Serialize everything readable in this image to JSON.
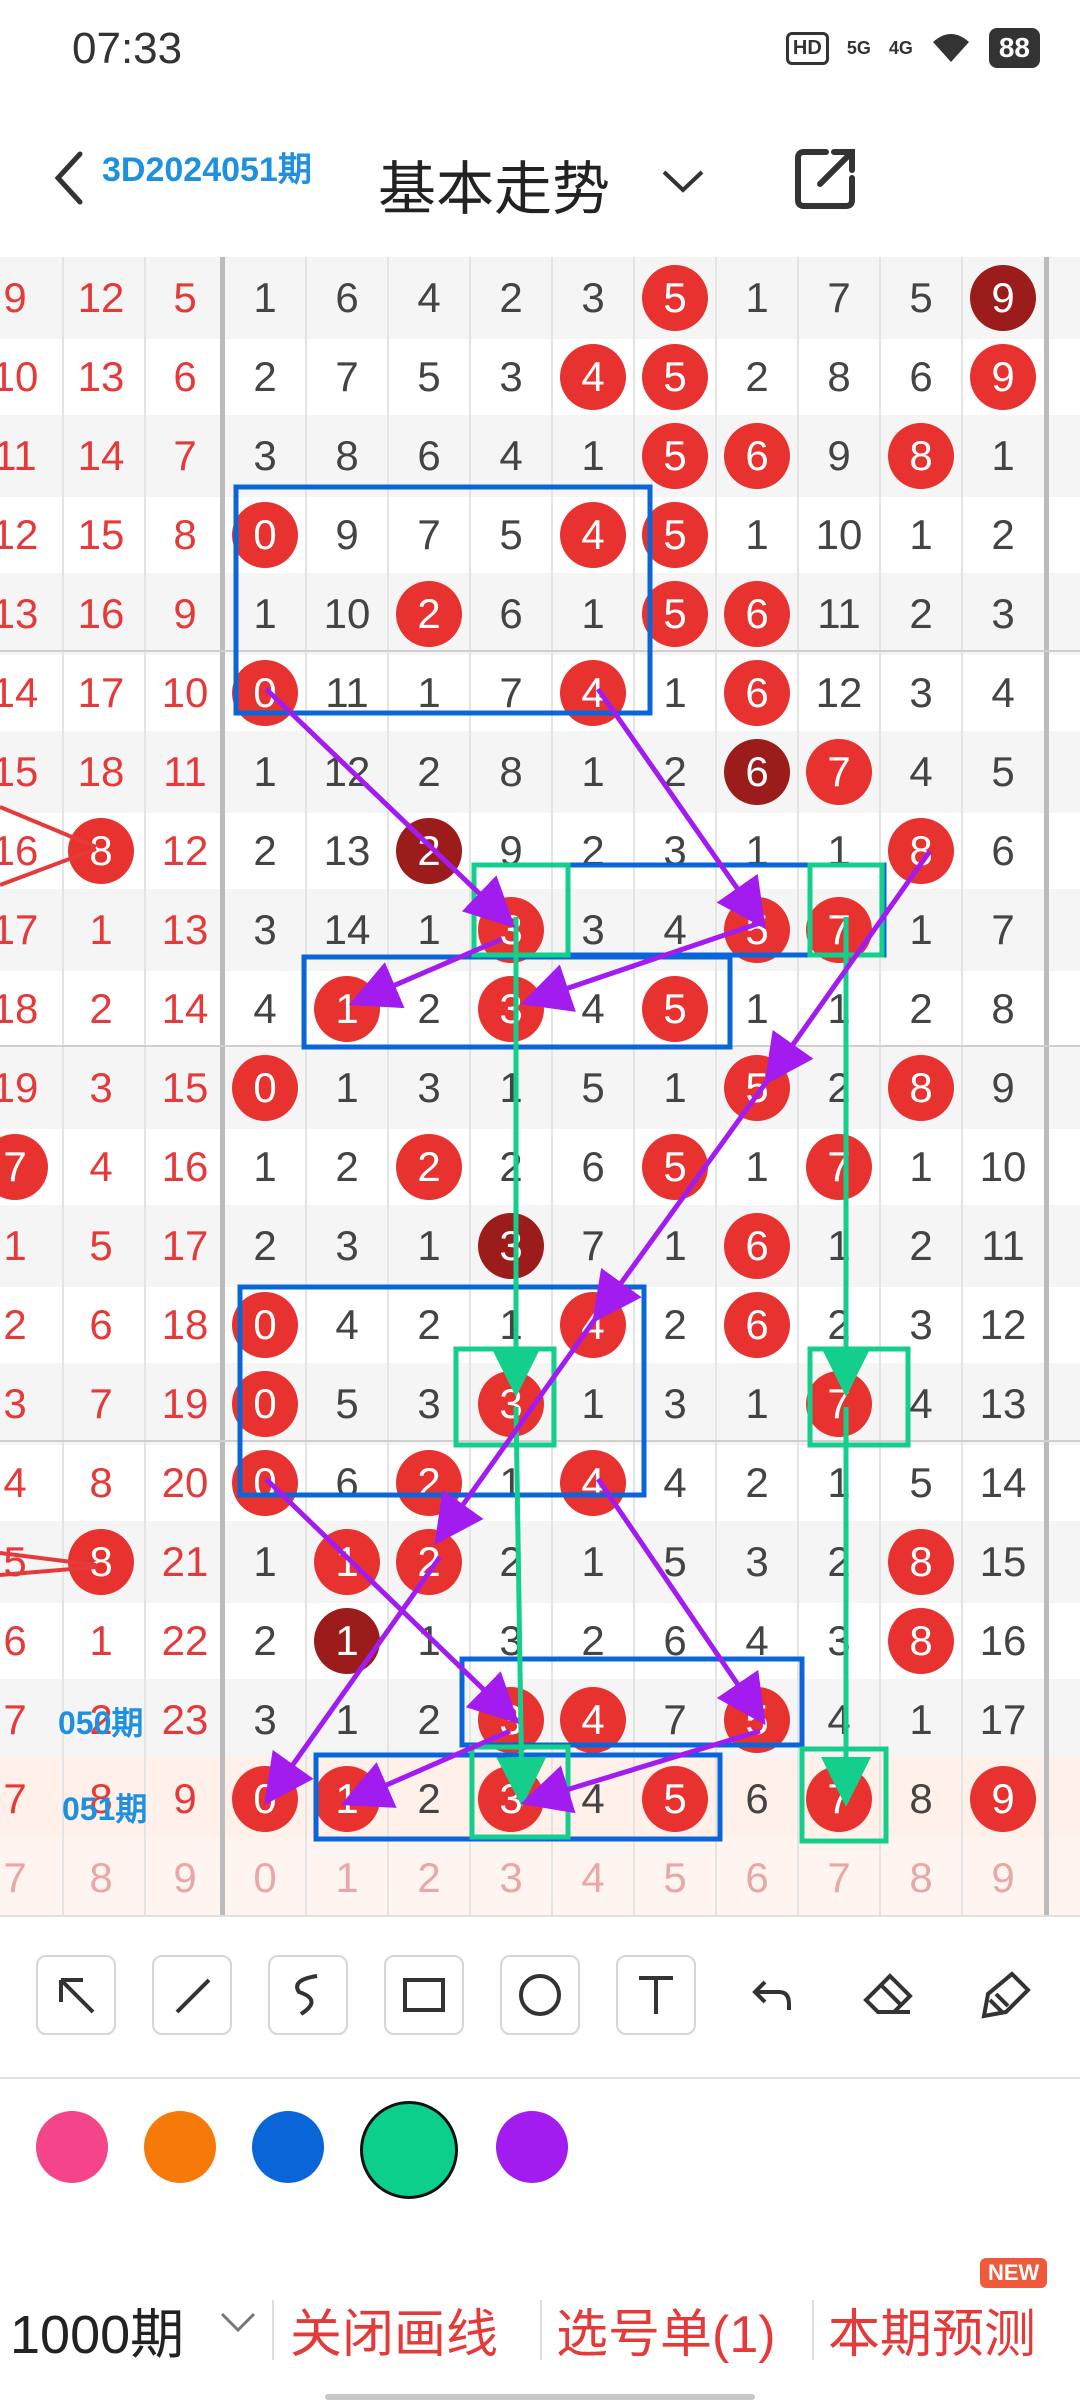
{
  "status": {
    "time": "07:33",
    "hd": "HD",
    "hd_sub": "1 2",
    "sig1": "5G",
    "sig2": "4G",
    "battery": "88"
  },
  "header": {
    "issue": "3D2024051期",
    "title": "基本走势"
  },
  "labels": {
    "row050": "050期",
    "row051": "051期"
  },
  "rows": [
    {
      "l": [
        "9",
        "12",
        "5"
      ],
      "r": [
        "1",
        "6",
        "4",
        "2",
        "3",
        "5",
        "1",
        "7",
        "5",
        "9"
      ],
      "balls": [
        5,
        9
      ],
      "dark": [
        9
      ],
      "bg": "alt"
    },
    {
      "l": [
        "10",
        "13",
        "6"
      ],
      "r": [
        "2",
        "7",
        "5",
        "3",
        "4",
        "5",
        "2",
        "8",
        "6",
        "9"
      ],
      "balls": [
        4,
        5,
        9
      ],
      "dark": [],
      "bg": ""
    },
    {
      "l": [
        "11",
        "14",
        "7"
      ],
      "r": [
        "3",
        "8",
        "6",
        "4",
        "1",
        "5",
        "6",
        "9",
        "8",
        "1"
      ],
      "balls": [
        5,
        6,
        8
      ],
      "dark": [],
      "bg": "alt"
    },
    {
      "l": [
        "12",
        "15",
        "8"
      ],
      "r": [
        "0",
        "9",
        "7",
        "5",
        "4",
        "5",
        "1",
        "10",
        "1",
        "2"
      ],
      "balls": [
        0,
        4,
        5
      ],
      "dark": [],
      "bg": ""
    },
    {
      "l": [
        "13",
        "16",
        "9"
      ],
      "r": [
        "1",
        "10",
        "2",
        "6",
        "1",
        "5",
        "6",
        "11",
        "2",
        "3"
      ],
      "balls": [
        2,
        5,
        6
      ],
      "dark": [],
      "bg": "alt"
    },
    {
      "l": [
        "14",
        "17",
        "10"
      ],
      "r": [
        "0",
        "11",
        "1",
        "7",
        "4",
        "1",
        "6",
        "12",
        "3",
        "4"
      ],
      "balls": [
        0,
        4,
        6
      ],
      "dark": [],
      "bg": ""
    },
    {
      "l": [
        "15",
        "18",
        "11"
      ],
      "r": [
        "1",
        "12",
        "2",
        "8",
        "1",
        "2",
        "6",
        "7",
        "4",
        "5"
      ],
      "balls": [
        6,
        7
      ],
      "dark": [
        6
      ],
      "bg": "alt"
    },
    {
      "l": [
        "16",
        "8",
        "12"
      ],
      "r": [
        "2",
        "13",
        "2",
        "9",
        "2",
        "3",
        "1",
        "1",
        "8",
        "6"
      ],
      "balls": [
        2,
        8
      ],
      "dark": [
        2
      ],
      "lball": [
        1
      ],
      "bg": ""
    },
    {
      "l": [
        "17",
        "1",
        "13"
      ],
      "r": [
        "3",
        "14",
        "1",
        "3",
        "3",
        "4",
        "5",
        "7",
        "1",
        "7"
      ],
      "balls": [
        3,
        6,
        7
      ],
      "dark": [],
      "bg": "alt"
    },
    {
      "l": [
        "18",
        "2",
        "14"
      ],
      "r": [
        "4",
        "1",
        "2",
        "3",
        "4",
        "5",
        "1",
        "1",
        "2",
        "8"
      ],
      "balls": [
        1,
        3,
        5
      ],
      "dark": [],
      "bg": ""
    },
    {
      "l": [
        "19",
        "3",
        "15"
      ],
      "r": [
        "0",
        "1",
        "3",
        "1",
        "5",
        "1",
        "5",
        "2",
        "8",
        "9"
      ],
      "balls": [
        0,
        6,
        8
      ],
      "dark": [],
      "bg": "alt"
    },
    {
      "l": [
        "7",
        "4",
        "16"
      ],
      "r": [
        "1",
        "2",
        "2",
        "2",
        "6",
        "5",
        "1",
        "7",
        "1",
        "10"
      ],
      "balls": [
        2,
        5,
        7
      ],
      "dark": [],
      "lball": [
        0
      ],
      "bg": ""
    },
    {
      "l": [
        "1",
        "5",
        "17"
      ],
      "r": [
        "2",
        "3",
        "1",
        "3",
        "7",
        "1",
        "6",
        "1",
        "2",
        "11"
      ],
      "balls": [
        3,
        6
      ],
      "dark": [
        3
      ],
      "bg": "alt"
    },
    {
      "l": [
        "2",
        "6",
        "18"
      ],
      "r": [
        "0",
        "4",
        "2",
        "1",
        "4",
        "2",
        "6",
        "2",
        "3",
        "12"
      ],
      "balls": [
        0,
        4,
        6
      ],
      "dark": [],
      "bg": ""
    },
    {
      "l": [
        "3",
        "7",
        "19"
      ],
      "r": [
        "0",
        "5",
        "3",
        "3",
        "1",
        "3",
        "1",
        "7",
        "4",
        "13"
      ],
      "balls": [
        0,
        3,
        7
      ],
      "dark": [],
      "bg": "alt"
    },
    {
      "l": [
        "4",
        "8",
        "20"
      ],
      "r": [
        "0",
        "6",
        "2",
        "1",
        "4",
        "4",
        "2",
        "1",
        "5",
        "14"
      ],
      "balls": [
        0,
        2,
        4
      ],
      "dark": [],
      "bg": ""
    },
    {
      "l": [
        "5",
        "8",
        "21"
      ],
      "r": [
        "1",
        "1",
        "2",
        "2",
        "1",
        "5",
        "3",
        "2",
        "8",
        "15"
      ],
      "balls": [
        1,
        2,
        8
      ],
      "dark": [],
      "lball": [
        1
      ],
      "bg": "alt"
    },
    {
      "l": [
        "6",
        "1",
        "22"
      ],
      "r": [
        "2",
        "1",
        "1",
        "3",
        "2",
        "6",
        "4",
        "3",
        "8",
        "16"
      ],
      "balls": [
        1,
        8
      ],
      "dark": [
        1
      ],
      "bg": ""
    },
    {
      "l": [
        "7",
        "2",
        "23"
      ],
      "r": [
        "3",
        "1",
        "2",
        "3",
        "4",
        "7",
        "5",
        "4",
        "1",
        "17"
      ],
      "balls": [
        3,
        4,
        6
      ],
      "dark": [],
      "bg": "alt"
    },
    {
      "l": [
        "7",
        "8",
        "9"
      ],
      "r": [
        "0",
        "1",
        "2",
        "3",
        "4",
        "5",
        "6",
        "7",
        "8",
        "9"
      ],
      "balls": [
        0,
        1,
        3,
        5,
        7,
        9
      ],
      "dark": [],
      "bg": "cur"
    },
    {
      "l": [
        "7",
        "8",
        "9"
      ],
      "r": [
        "0",
        "1",
        "2",
        "3",
        "4",
        "5",
        "6",
        "7",
        "8",
        "9"
      ],
      "balls": [],
      "dark": [],
      "bg": "last"
    }
  ],
  "tools": [
    "select-arrow-icon",
    "line-icon",
    "freehand-icon",
    "rectangle-icon",
    "circle-icon",
    "text-icon",
    "undo-icon",
    "eraser-icon",
    "clear-brush-icon"
  ],
  "colors": {
    "pink": "#f4458a",
    "orange": "#f57a0a",
    "blue": "#0a66d8",
    "green": "#0ccf8c",
    "purple": "#a21cf0",
    "selected": "green"
  },
  "bottom": {
    "period": "1000期",
    "close_lines": "关闭画线",
    "pick_list": "选号单(1)",
    "predict": "本期预测",
    "new_badge": "NEW"
  }
}
